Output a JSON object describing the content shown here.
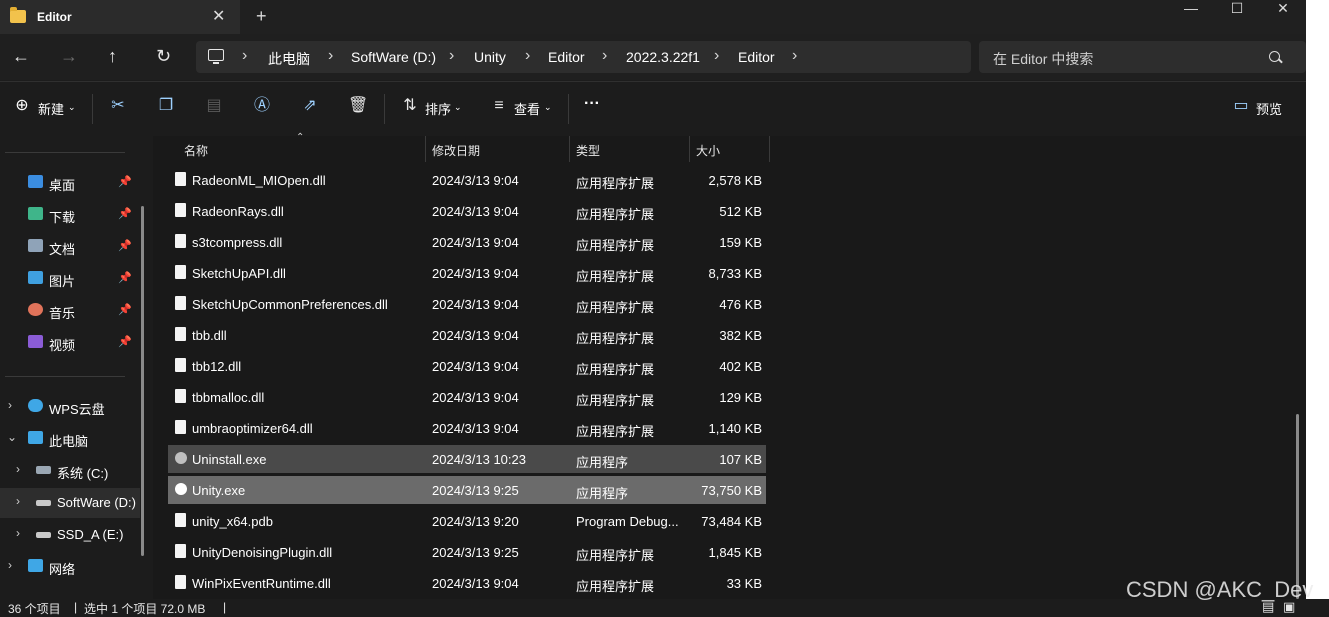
{
  "window": {
    "tab_title": "Editor",
    "controls": {
      "minimize": "—",
      "maximize": "☐",
      "close": "✕"
    }
  },
  "address": {
    "crumbs": [
      "此电脑",
      "SoftWare (D:)",
      "Unity",
      "Editor",
      "2022.3.22f1",
      "Editor"
    ],
    "search_placeholder": "在 Editor 中搜索"
  },
  "commands": {
    "new_label": "新建",
    "sort_label": "排序",
    "view_label": "查看",
    "more_label": "···",
    "preview_label": "预览"
  },
  "sidebar": {
    "quick": [
      {
        "label": "桌面",
        "color": "#3b8de0"
      },
      {
        "label": "下载",
        "color": "#3fb58a"
      },
      {
        "label": "文档",
        "color": "#8fa3b8"
      },
      {
        "label": "图片",
        "color": "#3fa0e0"
      },
      {
        "label": "音乐",
        "color": "#e0735a"
      },
      {
        "label": "视频",
        "color": "#8b5cd6"
      }
    ],
    "tree": [
      {
        "label": "WPS云盘"
      },
      {
        "label": "此电脑"
      },
      {
        "label": "系统 (C:)"
      },
      {
        "label": "SoftWare (D:)"
      },
      {
        "label": "SSD_A (E:)"
      },
      {
        "label": "网络"
      }
    ]
  },
  "columns": {
    "name": "名称",
    "date": "修改日期",
    "type": "类型",
    "size": "大小"
  },
  "files": [
    {
      "name": "RadeonML_MIOpen.dll",
      "date": "2024/3/13 9:04",
      "type": "应用程序扩展",
      "size": "2,578 KB"
    },
    {
      "name": "RadeonRays.dll",
      "date": "2024/3/13 9:04",
      "type": "应用程序扩展",
      "size": "512 KB"
    },
    {
      "name": "s3tcompress.dll",
      "date": "2024/3/13 9:04",
      "type": "应用程序扩展",
      "size": "159 KB"
    },
    {
      "name": "SketchUpAPI.dll",
      "date": "2024/3/13 9:04",
      "type": "应用程序扩展",
      "size": "8,733 KB"
    },
    {
      "name": "SketchUpCommonPreferences.dll",
      "date": "2024/3/13 9:04",
      "type": "应用程序扩展",
      "size": "476 KB"
    },
    {
      "name": "tbb.dll",
      "date": "2024/3/13 9:04",
      "type": "应用程序扩展",
      "size": "382 KB"
    },
    {
      "name": "tbb12.dll",
      "date": "2024/3/13 9:04",
      "type": "应用程序扩展",
      "size": "402 KB"
    },
    {
      "name": "tbbmalloc.dll",
      "date": "2024/3/13 9:04",
      "type": "应用程序扩展",
      "size": "129 KB"
    },
    {
      "name": "umbraoptimizer64.dll",
      "date": "2024/3/13 9:04",
      "type": "应用程序扩展",
      "size": "1,140 KB"
    },
    {
      "name": "Uninstall.exe",
      "date": "2024/3/13 10:23",
      "type": "应用程序",
      "size": "107 KB"
    },
    {
      "name": "Unity.exe",
      "date": "2024/3/13 9:25",
      "type": "应用程序",
      "size": "73,750 KB"
    },
    {
      "name": "unity_x64.pdb",
      "date": "2024/3/13 9:20",
      "type": "Program Debug...",
      "size": "73,484 KB"
    },
    {
      "name": "UnityDenoisingPlugin.dll",
      "date": "2024/3/13 9:25",
      "type": "应用程序扩展",
      "size": "1,845 KB"
    },
    {
      "name": "WinPixEventRuntime.dll",
      "date": "2024/3/13 9:04",
      "type": "应用程序扩展",
      "size": "33 KB"
    }
  ],
  "status": {
    "count": "36 个项目",
    "selection": "选中 1 个项目  72.0 MB"
  },
  "watermark": "CSDN @AKC_Dev"
}
